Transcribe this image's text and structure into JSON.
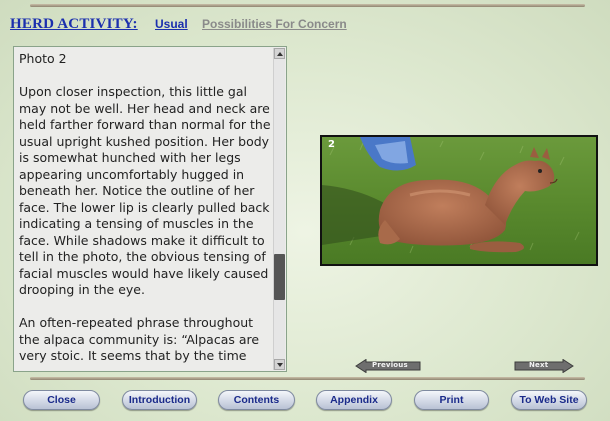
{
  "header": {
    "title": "HERD ACTIVITY:",
    "tabs": [
      {
        "label": "Usual",
        "active": true
      },
      {
        "label": "Possibilities For Concern",
        "active": false
      }
    ]
  },
  "text_panel": {
    "paragraphs": [
      "Photo 2",
      "Upon closer inspection, this little gal may not be well. Her head and neck are held farther forward than normal for the usual upright kushed position. Her body is somewhat hunched with her legs appearing uncomfortably hugged in beneath her. Notice the outline of her face. The lower lip is clearly pulled back indicating a tensing of muscles in the face. While shadows make it difficult to tell in the photo, the obvious tensing of facial muscles would have likely caused drooping in the eye.",
      "An often-repeated phrase throughout the alpaca community is: “Alpacas are very stoic. It seems that by the time"
    ]
  },
  "photo": {
    "number_label": "2",
    "subject": "brown alpaca lying in grass"
  },
  "nav": {
    "previous": "Previous",
    "next": "Next"
  },
  "buttons": {
    "close": "Close",
    "introduction": "Introduction",
    "contents": "Contents",
    "appendix": "Appendix",
    "print": "Print",
    "web_site": "To Web Site"
  },
  "colors": {
    "title_blue": "#1b2fae",
    "inactive_tab": "#8a8a8a",
    "background": "#dde8cf",
    "button_text": "#1a2a8a"
  }
}
